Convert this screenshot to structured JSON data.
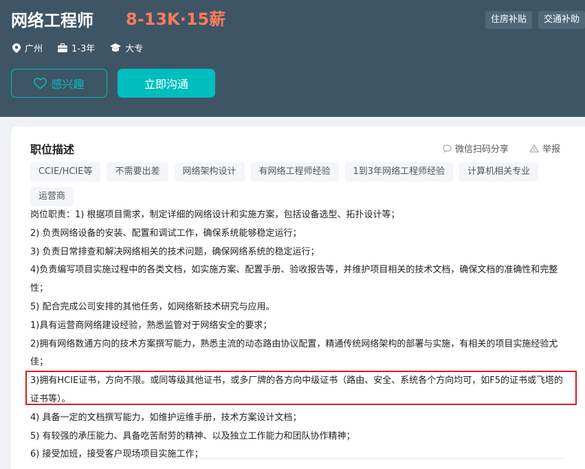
{
  "header": {
    "job_title": "网络工程师",
    "salary": "8-13K·15薪",
    "benefits": [
      "住房补贴",
      "交通补助"
    ],
    "meta": {
      "city": "广州",
      "experience": "1-3年",
      "education": "大专"
    },
    "like_button": "感兴趣",
    "chat_button": "立即沟通"
  },
  "section": {
    "title": "职位描述",
    "share_label": "微信扫码分享",
    "report_label": "举报",
    "tags": [
      "CCIE/HCIE等",
      "不需要出差",
      "网络架构设计",
      "有网络工程师经验",
      "1到3年网络工程师经验",
      "计算机相关专业",
      "运营商"
    ],
    "description": [
      "岗位职责：1) 根据项目需求，制定详细的网络设计和实施方案，包括设备选型、拓扑设计等；",
      "2) 负责网络设备的安装、配置和调试工作，确保系统能够稳定运行；",
      "3) 负责日常排查和解决网络相关的技术问题，确保网络系统的稳定运行；",
      "4)负责编写项目实施过程中的各类文档，如实施方案、配置手册、验收报告等，并维护项目相关的技术文档，确保文档的准确性和完整性；",
      "5) 配合完成公司安排的其他任务，如网络新技术研究与应用。",
      "1)具有运营商网络建设经验，熟悉监管对于网络安全的要求；",
      "2)拥有网络数通方向的技术方案撰写能力，熟悉主流的动态路由协议配置，精通传统网络架构的部署与实施，有相关的项目实施经验尤佳；",
      "3)拥有HCIE证书，方向不限。或同等级其他证书，或多厂牌的各方向中级证书（路由、安全、系统各个方向均可，如F5的证书或飞塔的证书等）。",
      "4) 具备一定的文档撰写能力，如维护运维手册，技术方案设计文档；",
      "5) 有较强的承压能力、具备吃苦耐劳的精神、以及独立工作能力和团队协作精神；",
      "6) 接受加班，接受客户现场项目实施工作；"
    ]
  },
  "colors": {
    "header_bg": "#3e5565",
    "accent": "#00bebd",
    "salary": "#ff7b5c",
    "highlight_border": "#e0181c"
  },
  "icons": [
    "location-icon",
    "briefcase-icon",
    "graduation-cap-icon",
    "heart-icon",
    "chat-bubble-icon",
    "warning-icon"
  ]
}
